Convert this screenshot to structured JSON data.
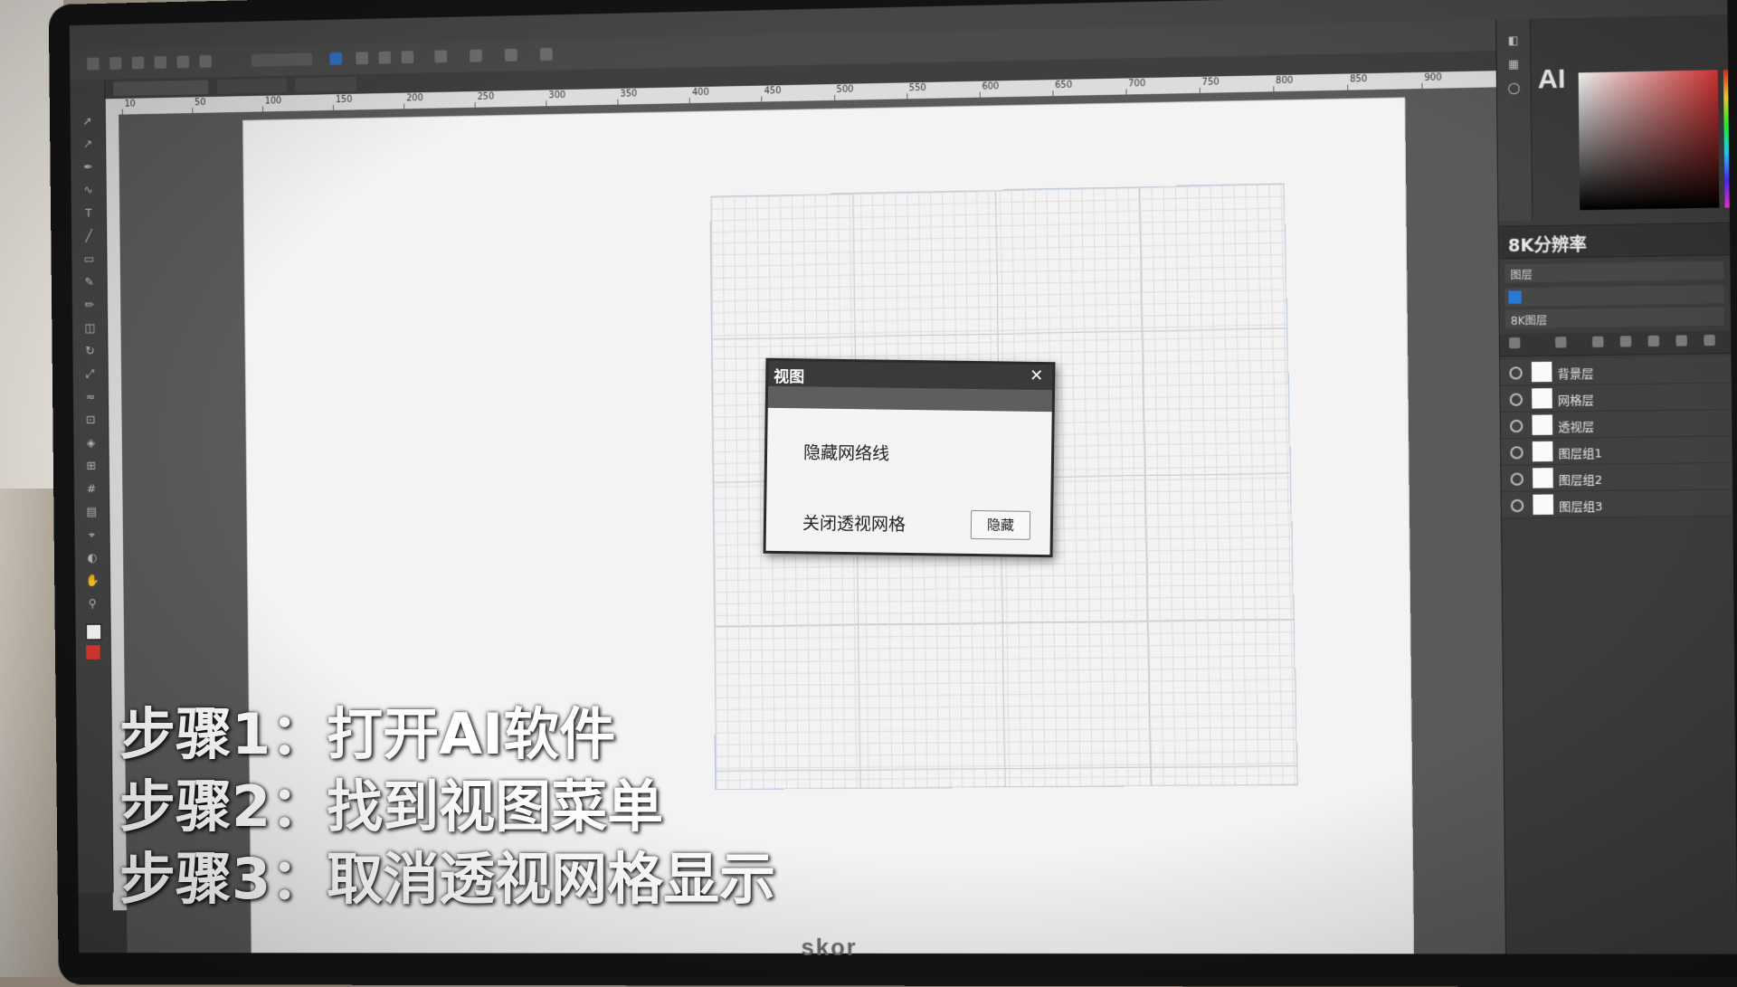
{
  "app": {
    "menu": [
      "",
      "",
      "",
      "",
      "",
      "",
      "",
      "",
      "",
      "",
      ""
    ],
    "logo_text": "AI",
    "brand": "skor"
  },
  "ruler": {
    "top_ticks": [
      "10",
      "50",
      "100",
      "150",
      "200",
      "250",
      "300",
      "350",
      "400",
      "450",
      "500",
      "550",
      "600",
      "650",
      "700",
      "750",
      "800",
      "850",
      "900"
    ]
  },
  "panel": {
    "section_title": "8K分辨率",
    "rows": [
      {
        "label": "图层",
        "value": ""
      },
      {
        "label": "",
        "value": ""
      },
      {
        "label": "8K图层",
        "value": ""
      }
    ],
    "layers": [
      {
        "name": "背景层"
      },
      {
        "name": "网格层"
      },
      {
        "name": "透视层"
      },
      {
        "name": "图层组1"
      },
      {
        "name": "图层组2"
      },
      {
        "name": "图层组3"
      }
    ]
  },
  "dialog": {
    "title": "视图",
    "close_icon": "close-icon",
    "option_hide": "隐藏网络线",
    "option_close": "关闭透视网格",
    "button": "隐藏"
  },
  "captions": {
    "step1": "步骤1：打开AI软件",
    "step2": "步骤2：找到视图菜单",
    "step3": "步骤3：取消透视网格显示"
  },
  "colors": {
    "accent": "#2a78d6",
    "panel_bg": "#3c3c3c",
    "artboard": "#f3f3f3"
  }
}
